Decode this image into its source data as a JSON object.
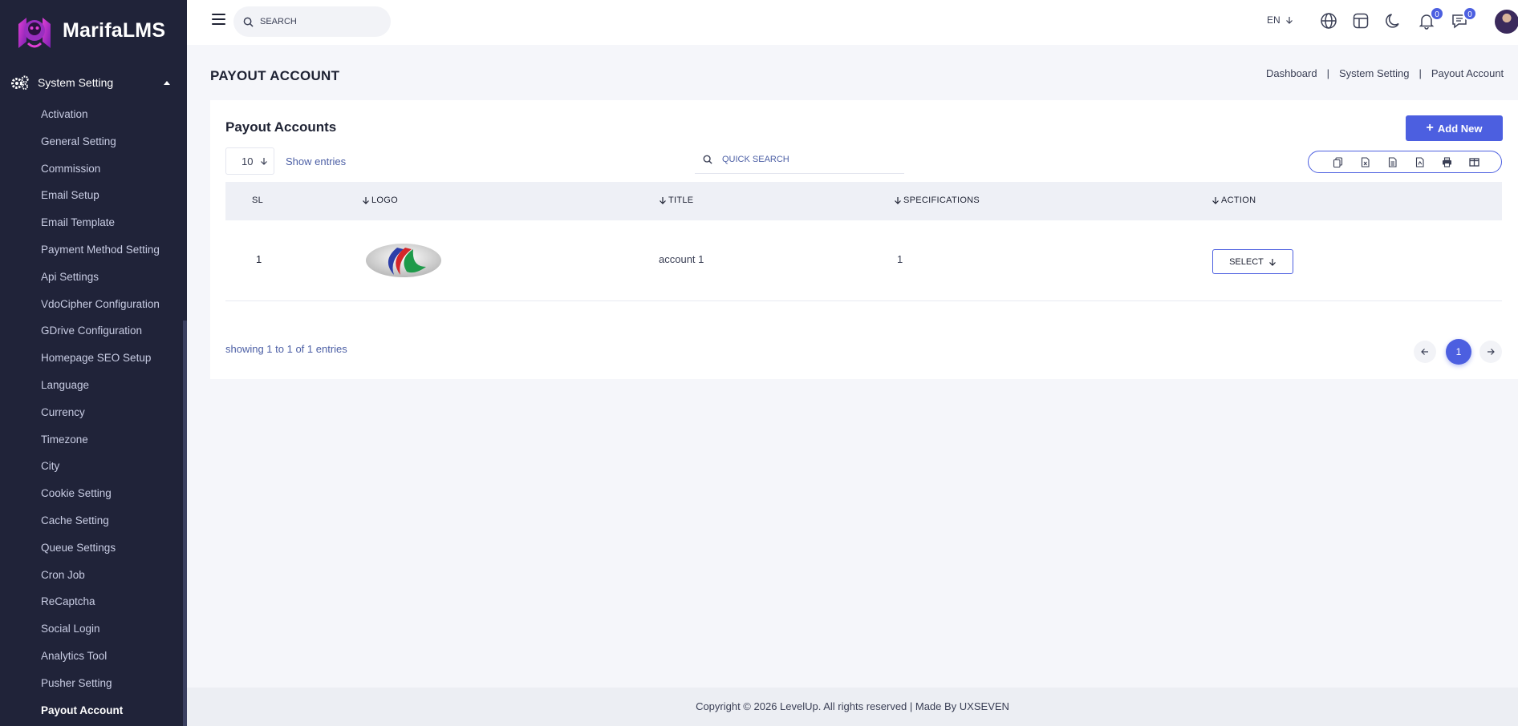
{
  "brand": {
    "name": "MarifaLMS"
  },
  "sidebar": {
    "section_label": "System Setting",
    "items": [
      {
        "label": "Activation"
      },
      {
        "label": "General Setting"
      },
      {
        "label": "Commission"
      },
      {
        "label": "Email Setup"
      },
      {
        "label": "Email Template"
      },
      {
        "label": "Payment Method Setting"
      },
      {
        "label": "Api Settings"
      },
      {
        "label": "VdoCipher Configuration"
      },
      {
        "label": "GDrive Configuration"
      },
      {
        "label": "Homepage SEO Setup"
      },
      {
        "label": "Language"
      },
      {
        "label": "Currency"
      },
      {
        "label": "Timezone"
      },
      {
        "label": "City"
      },
      {
        "label": "Cookie Setting"
      },
      {
        "label": "Cache Setting"
      },
      {
        "label": "Queue Settings"
      },
      {
        "label": "Cron Job"
      },
      {
        "label": "ReCaptcha"
      },
      {
        "label": "Social Login"
      },
      {
        "label": "Analytics Tool"
      },
      {
        "label": "Pusher Setting"
      },
      {
        "label": "Payout Account"
      }
    ],
    "active_item": "Payout Account"
  },
  "topbar": {
    "search_placeholder": "SEARCH",
    "language": "EN",
    "notification_count": "0",
    "message_count": "0",
    "icons": [
      "menu-icon",
      "search-icon",
      "globe-icon",
      "layout-icon",
      "moon-icon",
      "bell-icon",
      "chat-icon"
    ]
  },
  "page": {
    "title": "PAYOUT ACCOUNT",
    "breadcrumb": [
      "Dashboard",
      "System Setting",
      "Payout Account"
    ]
  },
  "card": {
    "title": "Payout Accounts",
    "add_button": "Add New",
    "page_length": "10",
    "show_entries": "Show entries",
    "quick_search_placeholder": "QUICK SEARCH",
    "export_icons": [
      "copy-icon",
      "excel-icon",
      "csv-icon",
      "pdf-icon",
      "print-icon",
      "columns-icon"
    ]
  },
  "table": {
    "headers": {
      "sl": "SL",
      "logo": "LOGO",
      "title": "TITLE",
      "specifications": "SPECIFICATIONS",
      "action": "ACTION"
    },
    "rows": [
      {
        "sl": "1",
        "title": "account 1",
        "specifications": "1",
        "action": "SELECT"
      }
    ],
    "showing": "showing 1 to 1 of 1 entries",
    "current_page": "1"
  },
  "footer": {
    "text": "Copyright © 2026 LevelUp. All rights reserved | Made By UXSEVEN"
  },
  "colors": {
    "accent": "#4c5fe0",
    "sidebar_bg": "#202339",
    "page_bg": "#f5f6fa"
  }
}
